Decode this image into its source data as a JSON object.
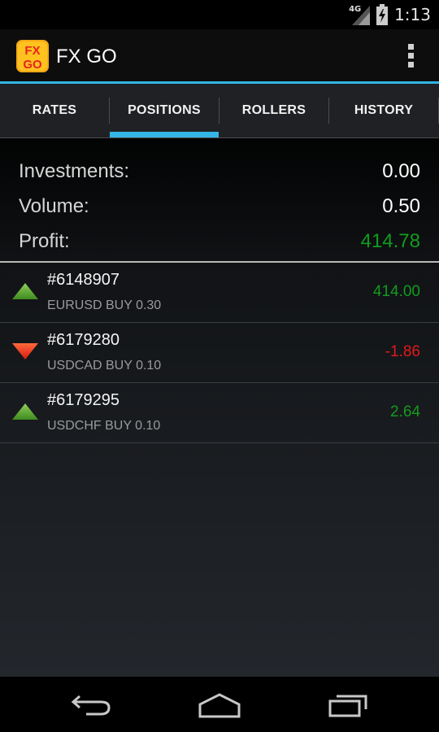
{
  "status_bar": {
    "network": "4G",
    "time": "1:13",
    "icons": [
      "signal-icon",
      "battery-icon"
    ]
  },
  "app": {
    "title": "FX GO",
    "logo_text_top": "FX",
    "logo_text_bottom": "GO",
    "accent_color": "#33b5e5"
  },
  "tabs": [
    {
      "label": "RATES",
      "selected": false
    },
    {
      "label": "POSITIONS",
      "selected": true
    },
    {
      "label": "ROLLERS",
      "selected": false
    },
    {
      "label": "HISTORY",
      "selected": false
    }
  ],
  "summary": {
    "investments_label": "Investments:",
    "investments_value": "0.00",
    "volume_label": "Volume:",
    "volume_value": "0.50",
    "profit_label": "Profit:",
    "profit_value": "414.78"
  },
  "positions": [
    {
      "id": "#6148907",
      "detail": "EURUSD BUY 0.30",
      "value": "414.00",
      "direction": "up"
    },
    {
      "id": "#6179280",
      "detail": "USDCAD BUY 0.10",
      "value": "-1.86",
      "direction": "down"
    },
    {
      "id": "#6179295",
      "detail": "USDCHF BUY 0.10",
      "value": "2.64",
      "direction": "up"
    }
  ],
  "colors": {
    "profit_green": "#129b1e",
    "loss_red": "#e01a1a"
  },
  "nav": {
    "icons": [
      "back-icon",
      "home-icon",
      "recents-icon"
    ]
  }
}
